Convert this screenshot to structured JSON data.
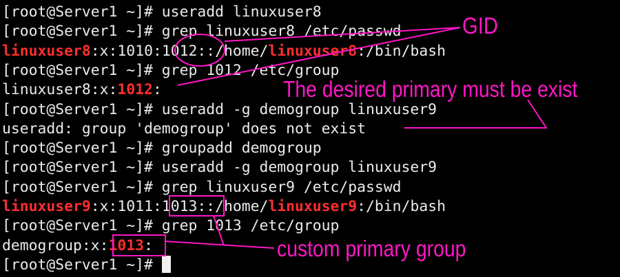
{
  "terminal": {
    "lines": [
      [
        {
          "t": "[root@Server1 ~]# useradd linuxuser8"
        }
      ],
      [
        {
          "t": "[root@Server1 ~]# grep linuxuser8 /etc/passwd"
        }
      ],
      [
        {
          "t": "linuxuser8",
          "c": "red"
        },
        {
          "t": ":x:1010:1012::/home/"
        },
        {
          "t": "linuxuser8",
          "c": "red"
        },
        {
          "t": ":/bin/bash"
        }
      ],
      [
        {
          "t": "[root@Server1 ~]# grep 1012 /etc/group"
        }
      ],
      [
        {
          "t": "linuxuser8:x:"
        },
        {
          "t": "1012",
          "c": "red"
        },
        {
          "t": ":"
        }
      ],
      [
        {
          "t": "[root@Server1 ~]# useradd -g demogroup linuxuser9"
        }
      ],
      [
        {
          "t": "useradd: group 'demogroup' does not exist"
        }
      ],
      [
        {
          "t": "[root@Server1 ~]# groupadd demogroup"
        }
      ],
      [
        {
          "t": "[root@Server1 ~]# useradd -g demogroup linuxuser9"
        }
      ],
      [
        {
          "t": "[root@Server1 ~]# grep linuxuser9 /etc/passwd"
        }
      ],
      [
        {
          "t": "linuxuser9",
          "c": "red"
        },
        {
          "t": ":x:1011:1013::/home/"
        },
        {
          "t": "linuxuser9",
          "c": "red"
        },
        {
          "t": ":/bin/bash"
        }
      ],
      [
        {
          "t": "[root@Server1 ~]# grep 1013 /etc/group"
        }
      ],
      [
        {
          "t": "demogroup:x:"
        },
        {
          "t": "1013",
          "c": "red"
        },
        {
          "t": ":"
        }
      ],
      [
        {
          "t": "[root@Server1 ~]# "
        }
      ]
    ]
  },
  "annotations": {
    "gid": "GID",
    "primary_must_exist": "The desired primary must be exist",
    "custom_primary_group": "custom primary group",
    "color": "#ff17c6"
  },
  "colors": {
    "background": "#000000",
    "text": "#ececec",
    "highlight": "#ff2e2e"
  }
}
